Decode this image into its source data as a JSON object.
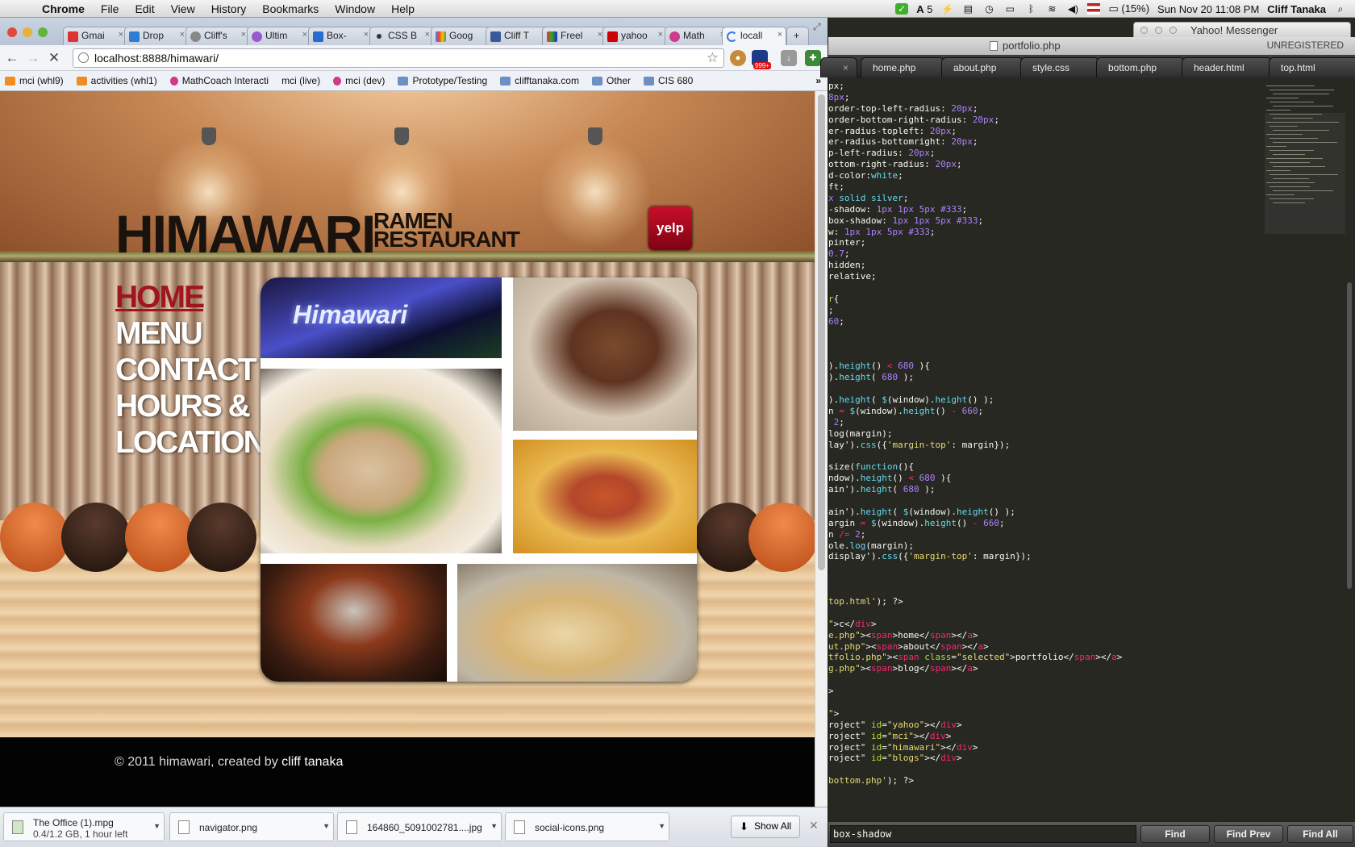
{
  "menubar": {
    "app_name": "Chrome",
    "items": [
      "File",
      "Edit",
      "View",
      "History",
      "Bookmarks",
      "Window",
      "Help"
    ],
    "status": {
      "adobe": "5",
      "battery": "(15%)",
      "clock": "Sun Nov 20  11:08 PM",
      "user": "Cliff Tanaka"
    }
  },
  "browser": {
    "tabs": [
      "Gmai",
      "Drop",
      "Cliff's",
      "Ultim",
      "Box-",
      "CSS B",
      "Goog",
      "Cliff T",
      "Freel",
      "yahoo",
      "Math",
      "locall"
    ],
    "address": "localhost:8888/himawari/",
    "ext_badge": "999+",
    "bookmarks": [
      "mci (whl9)",
      "activities (whl1)",
      "MathCoach Interacti",
      "mci (live)",
      "mci (dev)",
      "Prototype/Testing",
      "clifftanaka.com",
      "Other",
      "CIS 680"
    ],
    "more_bookmarks": "»"
  },
  "site": {
    "logo_main": "HIMAWARI",
    "logo_sub_1": "RAMEN",
    "logo_sub_2": "RESTAURANT",
    "yelp": "yelp",
    "nav": [
      "HOME",
      "MENU",
      "CONTACT",
      "HOURS &",
      "LOCATION"
    ],
    "gallery_sign": "Himawari",
    "footer_prefix": "© 2011 himawari, created by ",
    "footer_author": "cliff tanaka"
  },
  "downloads": {
    "items": [
      {
        "name": "The Office (1).mpg",
        "sub": "0.4/1.2 GB, 1 hour left"
      },
      {
        "name": "navigator.png",
        "sub": ""
      },
      {
        "name": "164860_5091002781....jpg",
        "sub": ""
      },
      {
        "name": "social-icons.png",
        "sub": ""
      }
    ],
    "show_all": "Show All"
  },
  "editor": {
    "title": "portfolio.php",
    "unregistered": "UNREGISTERED",
    "yahoo_title": "Yahoo! Messenger",
    "tabs": [
      "home.php",
      "about.php",
      "style.css",
      "bottom.php",
      "header.html",
      "top.html"
    ],
    "find_value": "box-shadow",
    "find_buttons": [
      "Find",
      "Find Prev",
      "Find All"
    ]
  },
  "colors": {
    "nav_selected": "#a1151e",
    "editor_bg": "#272822",
    "keyword": "#f92672",
    "number": "#ae81ff",
    "string": "#e6db74",
    "function": "#66d9ef"
  }
}
